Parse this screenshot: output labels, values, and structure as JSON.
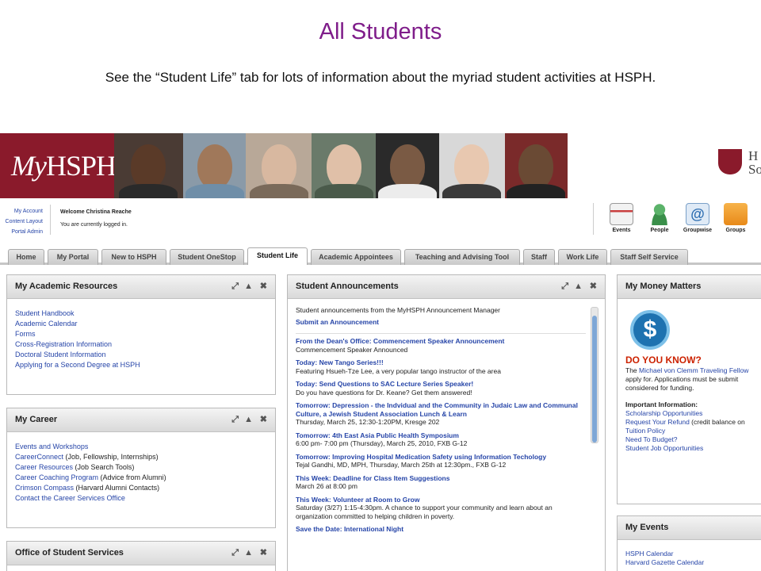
{
  "slide": {
    "title": "All Students",
    "subtitle": "See the “Student Life” tab for lots of information about the myriad student activities at HSPH."
  },
  "banner": {
    "logo_my": "My",
    "logo_hsph": "HSPH",
    "harvard_text": "H\nSo"
  },
  "userbar": {
    "links": [
      "My Account",
      "Content Layout",
      "Portal Admin"
    ],
    "welcome": "Welcome Christina Reache",
    "status": "You are currently logged in.",
    "quick_icons": [
      "Events",
      "People",
      "Groupwise",
      "Groups"
    ]
  },
  "tabs": [
    "Home",
    "My Portal",
    "New to HSPH",
    "Student OneStop",
    "Student Life",
    "Academic Appointees",
    "Teaching and Advising Tool",
    "Staff",
    "Work Life",
    "Staff Self Service"
  ],
  "active_tab": "Student Life",
  "academic": {
    "title": "My Academic Resources",
    "links": [
      "Student Handbook",
      "Academic Calendar",
      "Forms",
      "Cross-Registration Information",
      "Doctoral Student Information",
      "Applying for a Second Degree at HSPH"
    ]
  },
  "career": {
    "title": "My Career",
    "items": [
      {
        "link": "Events and Workshops",
        "extra": ""
      },
      {
        "link": "CareerConnect",
        "extra": " (Job, Fellowship, Internships)"
      },
      {
        "link": "Career Resources",
        "extra": " (Job Search Tools)"
      },
      {
        "link": "Career Coaching Program",
        "extra": " (Advice from Alumni)"
      },
      {
        "link": "Crimson Compass",
        "extra": " (Harvard Alumni Contacts)"
      },
      {
        "link": "Contact the Career Services Office",
        "extra": ""
      }
    ]
  },
  "office": {
    "title": "Office of Student Services"
  },
  "announcements": {
    "title": "Student Announcements",
    "intro": "Student announcements from the MyHSPH Announcement Manager",
    "submit": "Submit an Announcement",
    "items": [
      {
        "link": "From the Dean's Office: Commencement Speaker Announcement",
        "text": "Commencement Speaker Announced"
      },
      {
        "link": "Today: New Tango Series!!!",
        "text": "Featuring Hsueh-Tze Lee, a very popular tango instructor of the area"
      },
      {
        "link": "Today: Send Questions to SAC Lecture Series Speaker!",
        "text": "Do you have questions for Dr. Keane? Get them answered!"
      },
      {
        "link": "Tomorrow: Depression - the Indvidual and the Community in Judaic Law and Communal Culture, a Jewish Student Association Lunch & Learn",
        "text": "Thursday, March 25, 12:30-1:20PM, Kresge 202"
      },
      {
        "link": "Tomorrow: 4th East Asia Public Health Symposium",
        "text": "6:00 pm- 7:00 pm (Thursday), March 25, 2010, FXB G-12"
      },
      {
        "link": "Tomorrow: Improving Hospital Medication Safety using Information Techology",
        "text": "Tejal Gandhi, MD, MPH, Thursday, March 25th at 12:30pm., FXB G-12"
      },
      {
        "link": "This Week: Deadline for Class Item Suggestions",
        "text": "March 26 at 8:00 pm"
      },
      {
        "link": "This Week: Volunteer at Room to Grow",
        "text": "Saturday (3/27) 1:15-4:30pm. A chance to support your community and learn about an organization committed to helping children in poverty."
      },
      {
        "link": "Save the Date: International Night",
        "text": ""
      }
    ]
  },
  "money": {
    "title": "My Money Matters",
    "symbol": "$",
    "dyk": "DO YOU KNOW?",
    "dyk_pre": "The ",
    "dyk_link": "Michael von Clemm Traveling Fellow",
    "dyk_rest": "apply for. Applications must be submit considered for funding.",
    "important": "Important Information:",
    "items": [
      {
        "link": "Scholarship Opportunities",
        "extra": ""
      },
      {
        "link": "Request Your Refund",
        "extra": " (credit balance on"
      },
      {
        "link": "Tuition Policy",
        "extra": ""
      },
      {
        "link": "Need To Budget?",
        "extra": ""
      },
      {
        "link": "Student Job Opportunities",
        "extra": ""
      }
    ]
  },
  "events": {
    "title": "My Events",
    "links": [
      "HSPH Calendar",
      "Harvard Gazette Calendar"
    ]
  },
  "colors": {
    "title_purple": "#7f1d8a",
    "crimson": "#8a1a2b",
    "link_blue": "#2645a8",
    "alert_red": "#cc2200"
  }
}
